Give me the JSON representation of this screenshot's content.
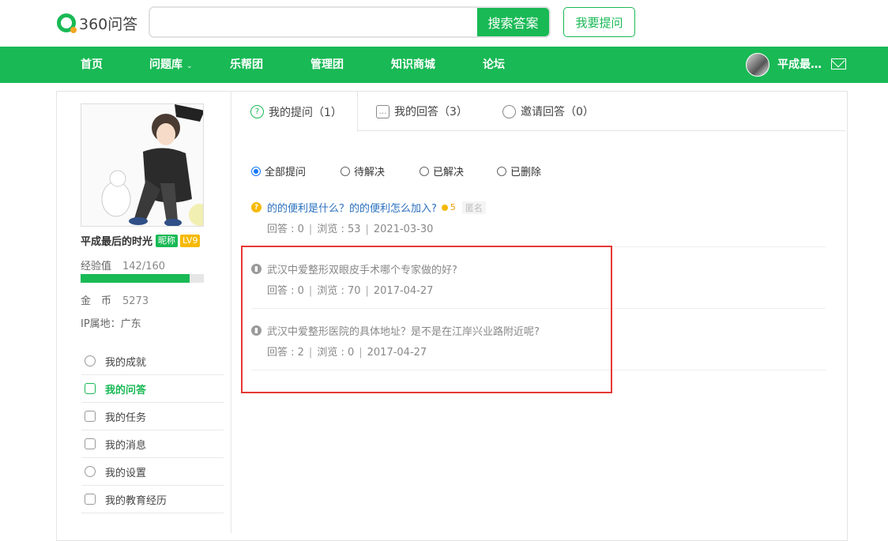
{
  "header": {
    "logo_text": "360问答",
    "search": {
      "placeholder": "",
      "button_label": "搜索答案"
    },
    "ask_button_label": "我要提问"
  },
  "nav": {
    "items": [
      {
        "label": "首页"
      },
      {
        "label": "问题库",
        "has_dropdown": true
      },
      {
        "label": "乐帮团"
      },
      {
        "label": "管理团"
      },
      {
        "label": "知识商城"
      },
      {
        "label": "论坛"
      }
    ],
    "caret": "⌄",
    "user_name": "平成最…"
  },
  "profile": {
    "name": "平成最后的时光",
    "badge_nick": "昵称",
    "badge_level": "LV9",
    "exp_label": "经验值",
    "exp_value": "142/160",
    "exp_fraction": 0.8875,
    "coin_label": "金　币",
    "coin_value": "5273",
    "ip_label": "IP属地：广东"
  },
  "sidebar_menu": [
    {
      "label": "我的成就",
      "icon": "medal-icon",
      "active": false
    },
    {
      "label": "我的问答",
      "icon": "question-icon",
      "active": true
    },
    {
      "label": "我的任务",
      "icon": "clipboard-icon",
      "active": false
    },
    {
      "label": "我的消息",
      "icon": "mail-icon",
      "active": false
    },
    {
      "label": "我的设置",
      "icon": "gear-icon",
      "active": false
    },
    {
      "label": "我的教育经历",
      "icon": "graduation-cap-icon",
      "active": false
    }
  ],
  "tabs": [
    {
      "label": "我的提问（1）",
      "icon": "question-circle-icon",
      "active": true
    },
    {
      "label": "我的回答（3）",
      "icon": "chat-bubble-icon",
      "active": false
    },
    {
      "label": "邀请回答（0）",
      "icon": "person-icon",
      "active": false
    }
  ],
  "filters": [
    {
      "label": "全部提问",
      "checked": true
    },
    {
      "label": "待解决",
      "checked": false
    },
    {
      "label": "已解决",
      "checked": false
    },
    {
      "label": "已删除",
      "checked": false
    }
  ],
  "questions": [
    {
      "title": "的的便利是什么？的的便利怎么加入?",
      "status": "open",
      "reward": "5",
      "anonymous": "匿名",
      "answers": "回答 : 0",
      "views": "浏览 : 53",
      "date": "2021-03-30"
    },
    {
      "title": "武汉中爱整形双眼皮手术哪个专家做的好?",
      "status": "deleted",
      "answers": "回答 : 0",
      "views": "浏览 : 70",
      "date": "2017-04-27"
    },
    {
      "title": "武汉中爱整形医院的具体地址？是不是在江岸兴业路附近呢?",
      "status": "deleted",
      "answers": "回答 : 2",
      "views": "浏览 : 0",
      "date": "2017-04-27"
    }
  ],
  "meta_separator": "|",
  "colors": {
    "brand": "#19b955",
    "highlight": "#e53935",
    "link": "#2a6fbf"
  }
}
